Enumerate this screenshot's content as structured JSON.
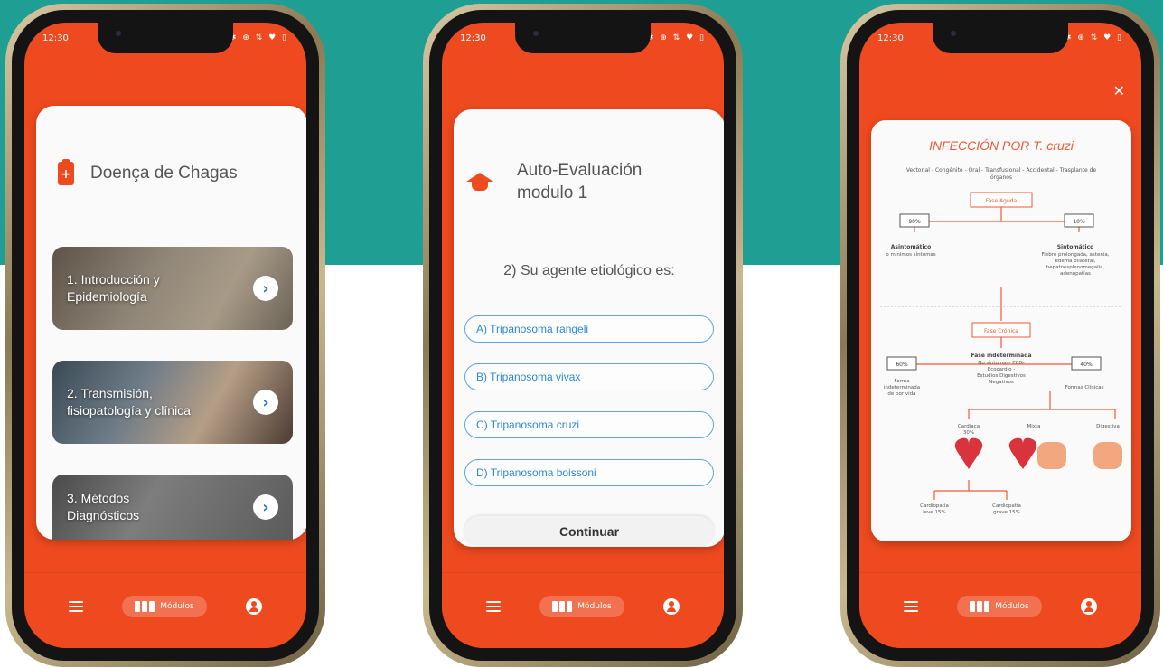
{
  "status": {
    "time": "12:30",
    "icons": "⏰ ✱ ⊕ ⇅ ♥ ▯"
  },
  "nav": {
    "modules_label": "Módulos"
  },
  "phone1": {
    "title": "Doença de Chagas",
    "modules": [
      {
        "label": "1. Introducción y\nEpidemiología"
      },
      {
        "label": "2. Transmisión,\nfisiopatología y clínica"
      },
      {
        "label": "3. Métodos\nDiagnósticos"
      }
    ]
  },
  "phone2": {
    "title": "Auto-Evaluación\nmodulo 1",
    "question": "2) Su agente etiológico es:",
    "options": [
      "A) Tripanosoma rangeli",
      "B) Tripanosoma vivax",
      "C) Tripanosoma cruzi",
      "D) Tripanosoma boissoni"
    ],
    "continue_label": "Continuar"
  },
  "phone3": {
    "title": "INFECCIÓN POR T. cruzi",
    "subtitle": "Vectorial - Congénito - Oral - Transfusional - Accidental - Trasplante de órganos",
    "fase_aguda": "Fase Aguda",
    "pct_90": "90%",
    "pct_10": "10%",
    "asintomatico": "Asintomático",
    "asintomatico_desc": "o mínimos síntomas",
    "sintomatico": "Sintomático",
    "sintomatico_desc": [
      "Fiebre prolongada, astenia,",
      "edema bilateral,",
      "hepatoesplenomegalia,",
      "adenopatías"
    ],
    "fase_cronica": "Fase Crónica",
    "pct_60": "60%",
    "pct_40": "40%",
    "fase_indeterminada": "Fase indeterminada",
    "indeterminada_desc": [
      "No síntomas- ECG-",
      "Ecocardio -",
      "Estudios Digestivos",
      "Negativos"
    ],
    "forma_indeterminada": [
      "Forma",
      "indeterminada",
      "de por vida"
    ],
    "formas_clinicas": "Formas Clínicas",
    "cardiaca": "Cardíaca",
    "cardiaca_pct": "30%",
    "mixta": "Mixta",
    "digestiva": "Digestiva",
    "cardiopatia_leve": [
      "Cardiopatía",
      "leve 15%"
    ],
    "cardiopatia_grave": [
      "Cardiopatía",
      "grave 15%"
    ]
  },
  "colors": {
    "teal": "#1f9e93",
    "orange": "#ef4a1f",
    "blue": "#2a8ad0"
  }
}
